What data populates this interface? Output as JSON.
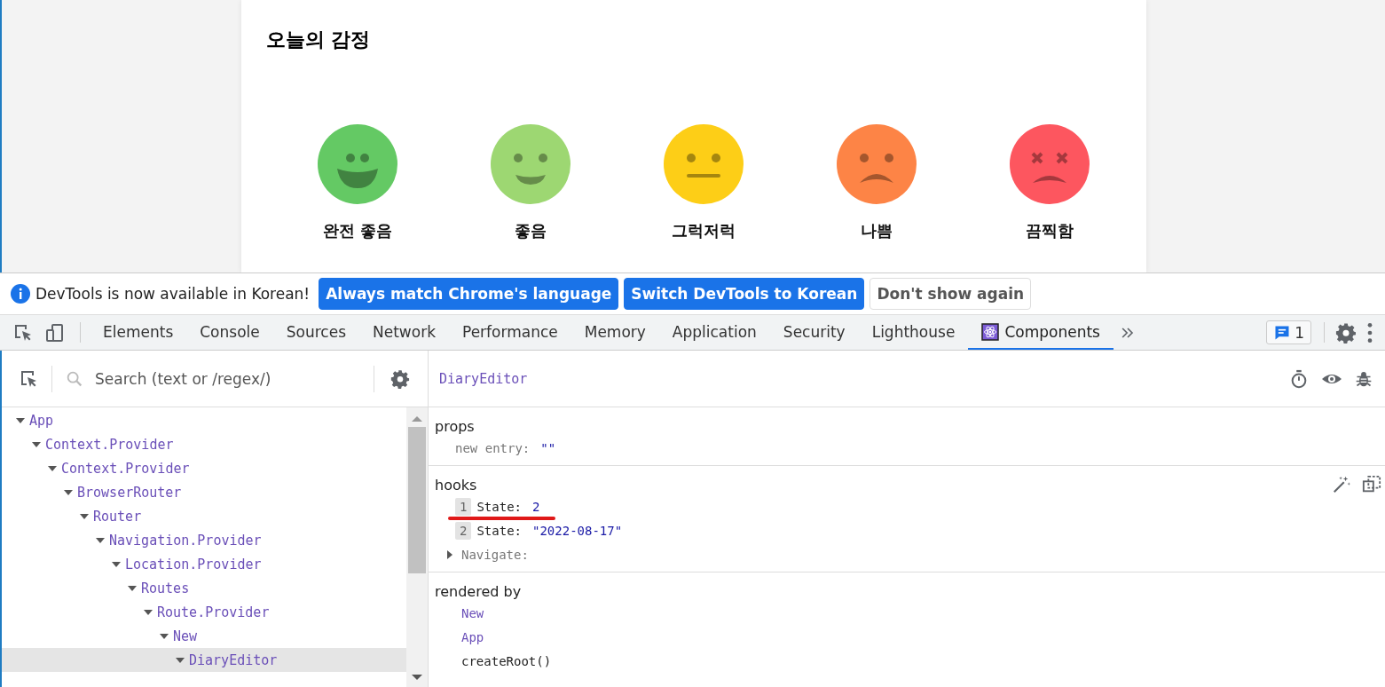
{
  "app": {
    "title": "오늘의 감정",
    "emotions": [
      {
        "kind": "great",
        "label": "완전 좋음",
        "color": "#64c964"
      },
      {
        "kind": "good",
        "label": "좋음",
        "color": "#9dd772"
      },
      {
        "kind": "neutral",
        "label": "그럭저럭",
        "color": "#fdce17"
      },
      {
        "kind": "bad",
        "label": "나쁨",
        "color": "#fd8446"
      },
      {
        "kind": "awful",
        "label": "끔찍함",
        "color": "#fd565f"
      }
    ]
  },
  "infobar": {
    "message": "DevTools is now available in Korean!",
    "buttons": [
      {
        "label": "Always match Chrome's language",
        "kind": "primary"
      },
      {
        "label": "Switch DevTools to Korean",
        "kind": "primary"
      },
      {
        "label": "Don't show again",
        "kind": "plain"
      }
    ]
  },
  "tabs": [
    {
      "label": "Elements",
      "selected": false
    },
    {
      "label": "Console",
      "selected": false
    },
    {
      "label": "Sources",
      "selected": false
    },
    {
      "label": "Network",
      "selected": false
    },
    {
      "label": "Performance",
      "selected": false
    },
    {
      "label": "Memory",
      "selected": false
    },
    {
      "label": "Application",
      "selected": false
    },
    {
      "label": "Security",
      "selected": false
    },
    {
      "label": "Lighthouse",
      "selected": false
    },
    {
      "label": "Components",
      "selected": true,
      "kind": "react"
    }
  ],
  "issues_badge": "1",
  "search": {
    "placeholder": "Search (text or /regex/)"
  },
  "tree": [
    {
      "label": "App",
      "expanded": true,
      "selected": false,
      "children": [
        {
          "label": "Context.Provider",
          "expanded": true,
          "selected": false,
          "children": [
            {
              "label": "Context.Provider",
              "expanded": true,
              "selected": false,
              "children": [
                {
                  "label": "BrowserRouter",
                  "expanded": true,
                  "selected": false,
                  "children": [
                    {
                      "label": "Router",
                      "expanded": true,
                      "selected": false,
                      "children": [
                        {
                          "label": "Navigation.Provider",
                          "expanded": true,
                          "selected": false,
                          "children": [
                            {
                              "label": "Location.Provider",
                              "expanded": true,
                              "selected": false,
                              "children": [
                                {
                                  "label": "Routes",
                                  "expanded": true,
                                  "selected": false,
                                  "children": [
                                    {
                                      "label": "Route.Provider",
                                      "expanded": true,
                                      "selected": false,
                                      "children": [
                                        {
                                          "label": "New",
                                          "expanded": true,
                                          "selected": false,
                                          "children": [
                                            {
                                              "label": "DiaryEditor",
                                              "expanded": true,
                                              "selected": true
                                            }
                                          ]
                                        }
                                      ]
                                    }
                                  ]
                                }
                              ]
                            }
                          ]
                        }
                      ]
                    }
                  ]
                }
              ]
            }
          ]
        }
      ]
    }
  ],
  "inspector": {
    "component": "DiaryEditor",
    "props": {
      "title": "props",
      "items": [
        {
          "key": "new entry:",
          "value": "\"\""
        }
      ]
    },
    "hooks": {
      "title": "hooks",
      "items": [
        {
          "kind": "indexed",
          "index": "1",
          "key": "State:",
          "value": "2",
          "underlined": true
        },
        {
          "kind": "indexed",
          "index": "2",
          "key": "State:",
          "value": "\"2022-08-17\"",
          "underlined": false
        },
        {
          "kind": "collapsed",
          "key": "Navigate:"
        }
      ]
    },
    "rendered_by": {
      "title": "rendered by",
      "items": [
        {
          "kind": "component",
          "label": "New"
        },
        {
          "kind": "component",
          "label": "App"
        },
        {
          "kind": "root",
          "label": "createRoot()"
        }
      ]
    }
  }
}
